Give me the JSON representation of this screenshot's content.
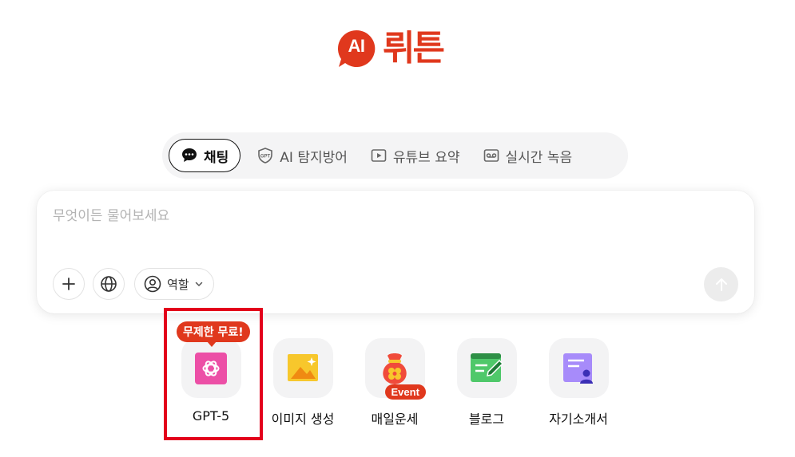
{
  "logo": {
    "badge": "AI",
    "name": "뤼튼"
  },
  "tabs": [
    {
      "label": "채팅",
      "icon": "chat-bubble-icon",
      "active": true
    },
    {
      "label": "AI 탐지방어",
      "icon": "gpt-shield-icon",
      "badge_text": "GPT"
    },
    {
      "label": "유튜브 요약",
      "icon": "play-icon"
    },
    {
      "label": "실시간 녹음",
      "icon": "voicemail-icon"
    }
  ],
  "chat": {
    "placeholder": "무엇이든 물어보세요",
    "role_label": "역할"
  },
  "features": [
    {
      "label": "GPT-5",
      "icon": "openai-icon",
      "badge": "무제한 무료!"
    },
    {
      "label": "이미지 생성",
      "icon": "image-icon"
    },
    {
      "label": "매일운세",
      "icon": "fortune-pouch-icon",
      "badge": "Event"
    },
    {
      "label": "블로그",
      "icon": "blog-edit-icon"
    },
    {
      "label": "자기소개서",
      "icon": "profile-doc-icon"
    }
  ],
  "colors": {
    "brand": "#e0381d",
    "highlight": "#e3001b"
  }
}
